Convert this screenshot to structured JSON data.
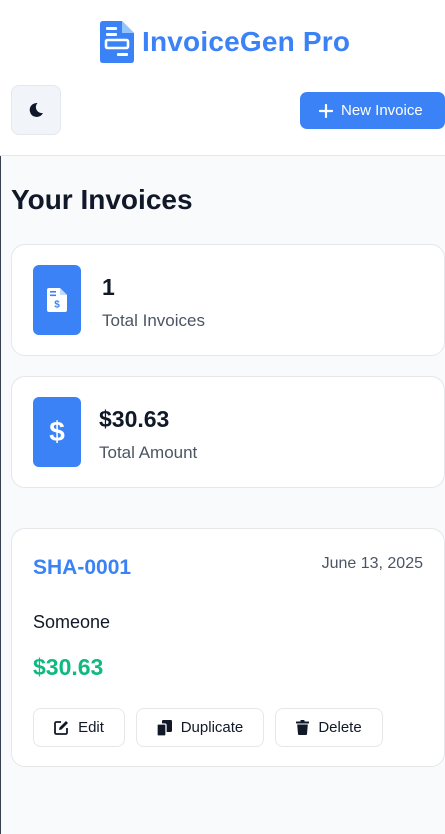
{
  "app": {
    "title": "InvoiceGen Pro",
    "accent_color": "#3b82f6",
    "success_color": "#10b981"
  },
  "header": {
    "theme_toggle_icon": "moon-icon",
    "new_invoice_label": "New Invoice"
  },
  "main": {
    "title": "Your Invoices",
    "stats": [
      {
        "icon": "invoice-file-icon",
        "value": "1",
        "label": "Total Invoices"
      },
      {
        "icon": "dollar-icon",
        "value": "$30.63",
        "label": "Total Amount"
      }
    ],
    "invoices": [
      {
        "number": "SHA-0001",
        "date": "June 13, 2025",
        "client": "Someone",
        "amount": "$30.63",
        "actions": {
          "edit": "Edit",
          "duplicate": "Duplicate",
          "delete": "Delete"
        }
      }
    ]
  }
}
